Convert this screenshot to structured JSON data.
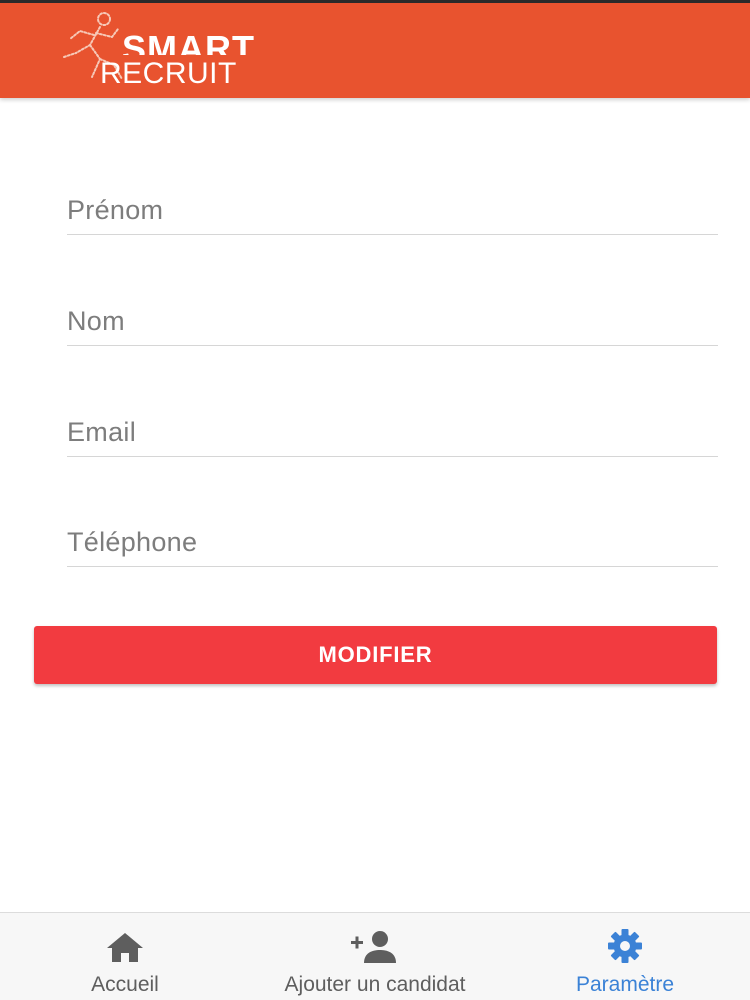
{
  "header": {
    "logo_top": "SMART",
    "logo_bottom": "RECRUIT",
    "background_color": "#e8532f"
  },
  "form": {
    "fields": [
      {
        "name": "prenom",
        "placeholder": "Prénom",
        "value": ""
      },
      {
        "name": "nom",
        "placeholder": "Nom",
        "value": ""
      },
      {
        "name": "email",
        "placeholder": "Email",
        "value": ""
      },
      {
        "name": "telephone",
        "placeholder": "Téléphone",
        "value": ""
      }
    ],
    "submit_label": "MODIFIER",
    "submit_color": "#f23b40"
  },
  "tabbar": {
    "active_color": "#3b82d6",
    "items": [
      {
        "label": "Accueil",
        "icon": "home-icon",
        "active": false
      },
      {
        "label": "Ajouter un candidat",
        "icon": "add-person-icon",
        "active": false
      },
      {
        "label": "Paramètre",
        "icon": "gear-icon",
        "active": true
      }
    ]
  }
}
